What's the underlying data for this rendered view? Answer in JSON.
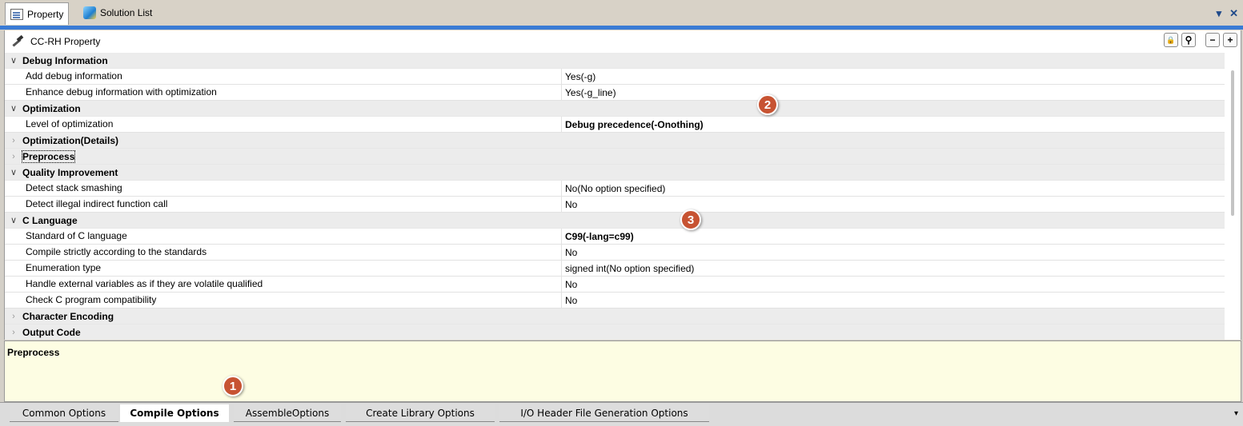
{
  "tabs": [
    {
      "label": "Property",
      "icon": "property-icon"
    },
    {
      "label": "Solution List",
      "icon": "solution-list-icon"
    }
  ],
  "window_controls": {
    "dropdown": "▾",
    "close": "✕"
  },
  "panel": {
    "title": "CC-RH Property",
    "buttons": [
      {
        "icon": "lock-icon",
        "glyph": "🔒"
      },
      {
        "icon": "search-icon",
        "glyph": "⚲"
      },
      {
        "icon": "minus-icon",
        "glyph": "−"
      },
      {
        "icon": "plus-icon",
        "glyph": "+"
      }
    ]
  },
  "grid": {
    "rows": [
      {
        "type": "cat",
        "expanded": true,
        "label": "Debug Information"
      },
      {
        "type": "item",
        "label": "Add debug information",
        "value": "Yes(-g)"
      },
      {
        "type": "item",
        "label": "Enhance debug information with optimization",
        "value": "Yes(-g_line)"
      },
      {
        "type": "cat",
        "expanded": true,
        "label": "Optimization"
      },
      {
        "type": "item",
        "label": "Level of optimization",
        "value": "Debug precedence(-Onothing)",
        "bold": true
      },
      {
        "type": "cat",
        "expanded": false,
        "label": "Optimization(Details)"
      },
      {
        "type": "cat",
        "expanded": false,
        "label": "Preprocess",
        "focused": true
      },
      {
        "type": "cat",
        "expanded": true,
        "label": "Quality Improvement"
      },
      {
        "type": "item",
        "label": "Detect stack smashing",
        "value": "No(No option specified)"
      },
      {
        "type": "item",
        "label": "Detect illegal indirect function call",
        "value": "No"
      },
      {
        "type": "cat",
        "expanded": true,
        "label": "C Language"
      },
      {
        "type": "item",
        "label": "Standard of C language",
        "value": "C99(-lang=c99)",
        "bold": true
      },
      {
        "type": "item",
        "label": "Compile strictly according to the standards",
        "value": "No"
      },
      {
        "type": "item",
        "label": "Enumeration type",
        "value": "signed int(No option specified)"
      },
      {
        "type": "item",
        "label": "Handle external variables as if they are volatile qualified",
        "value": "No"
      },
      {
        "type": "item",
        "label": "Check C program compatibility",
        "value": "No"
      },
      {
        "type": "cat",
        "expanded": false,
        "label": "Character Encoding"
      },
      {
        "type": "cat",
        "expanded": false,
        "label": "Output Code"
      }
    ]
  },
  "description": {
    "title": "Preprocess"
  },
  "bottom_tabs": [
    {
      "label": "Common Options"
    },
    {
      "label": "Compile Options",
      "active": true
    },
    {
      "label": "AssembleOptions"
    },
    {
      "label": "Create Library Options"
    },
    {
      "label": "I/O Header File Generation Options"
    }
  ],
  "bottom_tabs_arrow": "▾",
  "callouts": [
    "1",
    "2",
    "3"
  ],
  "colors": {
    "accent": "#3a7bd5",
    "callout": "#c75332",
    "description_bg": "#fdfde3"
  }
}
